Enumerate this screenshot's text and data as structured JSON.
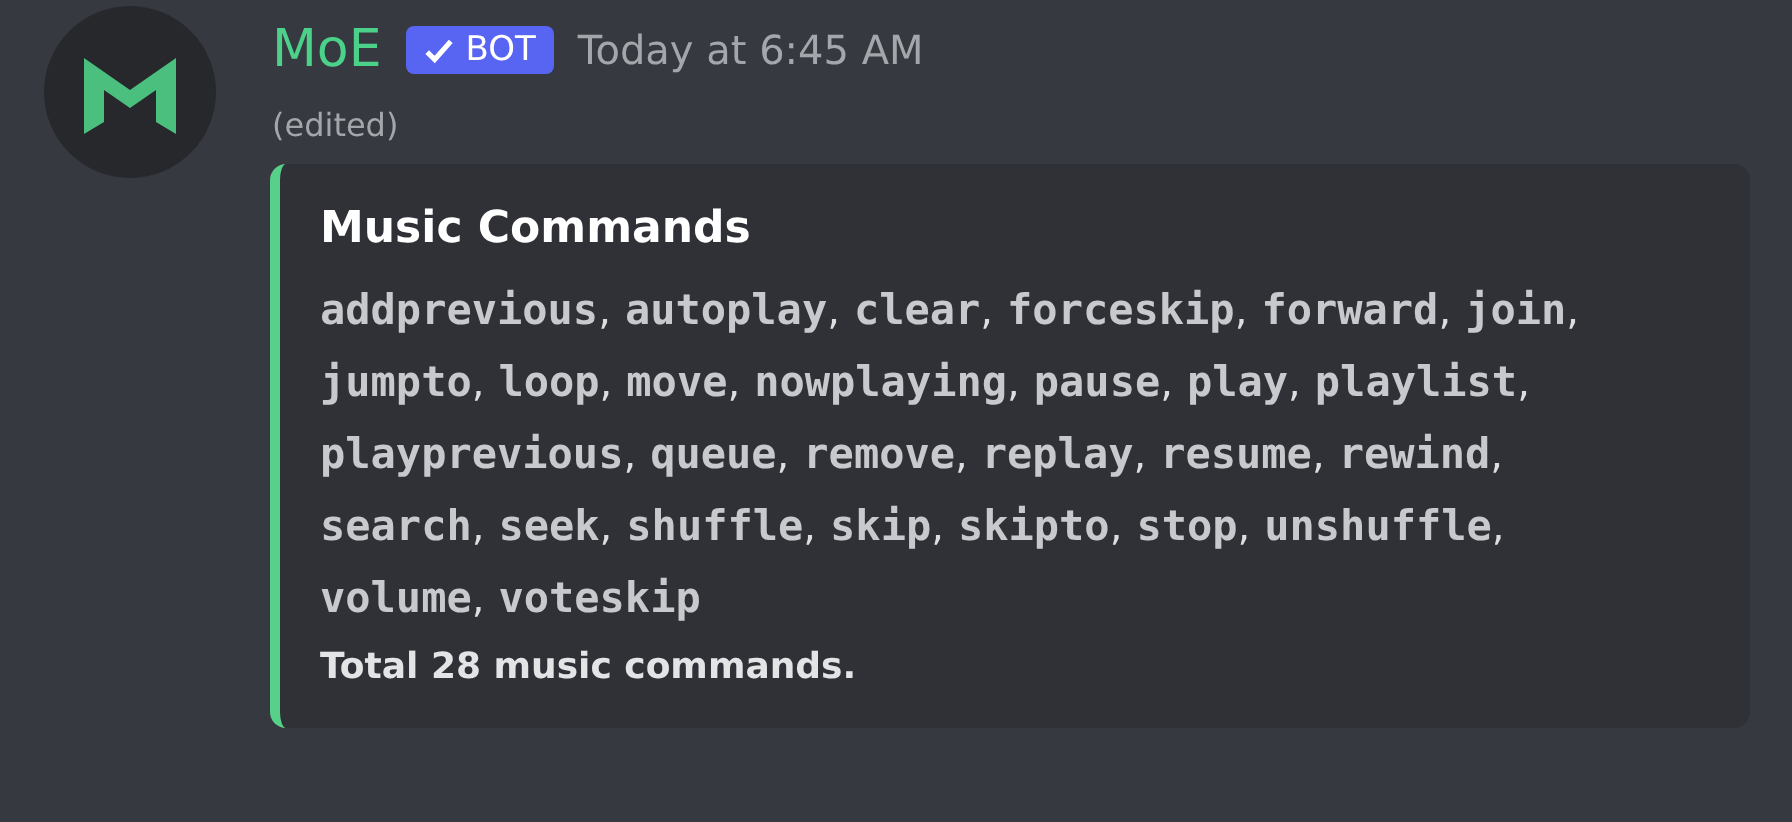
{
  "message": {
    "author": "MoE",
    "badge": "BOT",
    "timestamp": "Today at 6:45 AM",
    "edited": "(edited)"
  },
  "embed": {
    "title": "Music Commands",
    "color": "#57d18a",
    "lines": [
      [
        {
          "command": "addprevious",
          "separator": ","
        },
        {
          "command": "autoplay",
          "separator": ","
        },
        {
          "command": "clear",
          "separator": ","
        },
        {
          "command": "forceskip",
          "separator": ","
        },
        {
          "command": "forward",
          "separator": ","
        },
        {
          "command": "join",
          "separator": ","
        }
      ],
      [
        {
          "command": "jumpto",
          "separator": ","
        },
        {
          "command": "loop",
          "separator": ","
        },
        {
          "command": "move",
          "separator": ","
        },
        {
          "command": "nowplaying",
          "separator": ","
        },
        {
          "command": "pause",
          "separator": ","
        },
        {
          "command": "play",
          "separator": ","
        },
        {
          "command": "playlist",
          "separator": ","
        }
      ],
      [
        {
          "command": "playprevious",
          "separator": ","
        },
        {
          "command": "queue",
          "separator": ","
        },
        {
          "command": "remove",
          "separator": ","
        },
        {
          "command": "replay",
          "separator": ","
        },
        {
          "command": "resume",
          "separator": ","
        },
        {
          "command": "rewind",
          "separator": ","
        }
      ],
      [
        {
          "command": "search",
          "separator": ","
        },
        {
          "command": "seek",
          "separator": ","
        },
        {
          "command": "shuffle",
          "separator": ","
        },
        {
          "command": "skip",
          "separator": ","
        },
        {
          "command": "skipto",
          "separator": ","
        },
        {
          "command": "stop",
          "separator": ","
        },
        {
          "command": "unshuffle",
          "separator": ","
        }
      ],
      [
        {
          "command": "volume",
          "separator": ","
        },
        {
          "command": "voteskip"
        }
      ]
    ],
    "footer_text": "Total 28 music commands."
  }
}
